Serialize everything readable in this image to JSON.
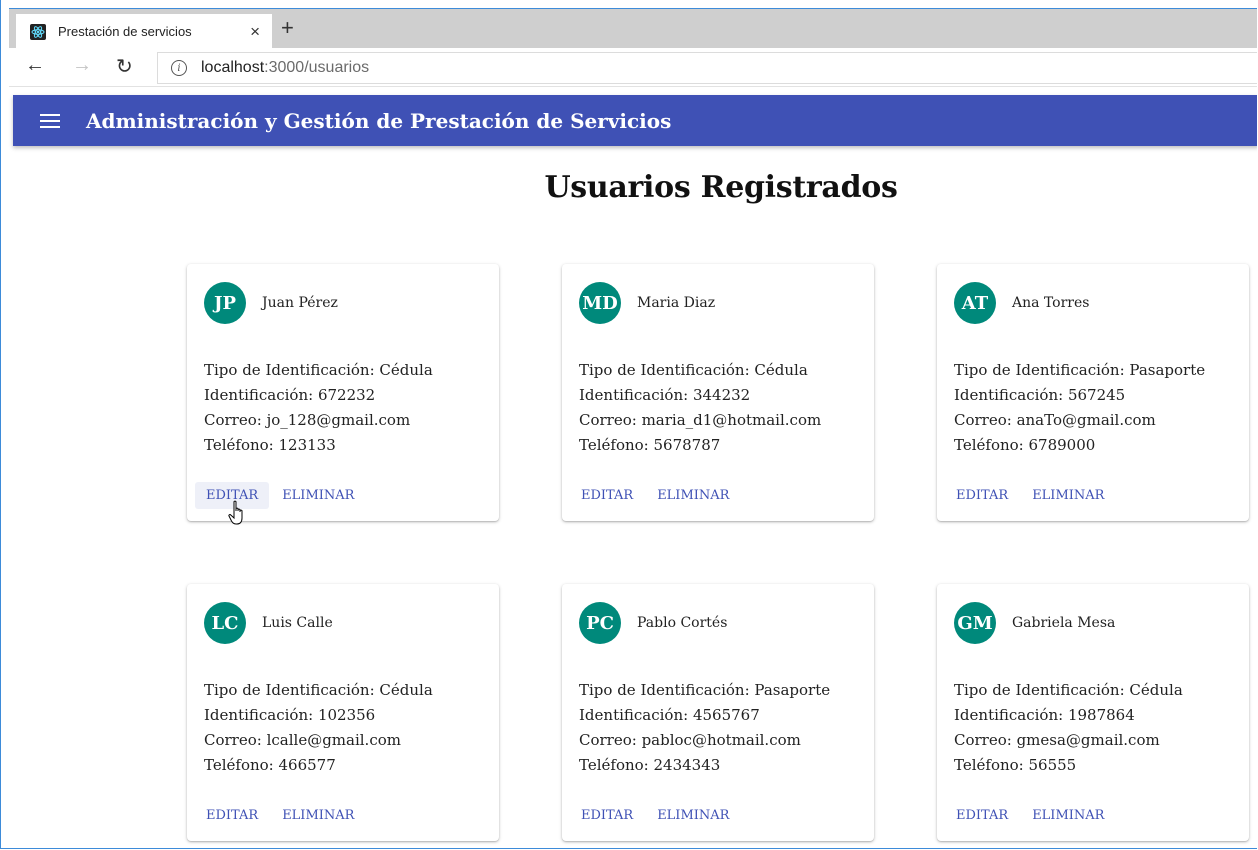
{
  "browser": {
    "tab_title": "Prestación de servicios",
    "tab_close": "×",
    "new_tab": "+",
    "back": "←",
    "forward": "→",
    "reload": "↻",
    "url_host": "localhost",
    "url_path": ":3000/usuarios"
  },
  "appbar": {
    "title": "Administración y Gestión de Prestación de Servicios"
  },
  "page": {
    "title": "Usuarios Registrados"
  },
  "labels": {
    "tipo": "Tipo de Identificación: ",
    "identificacion": "Identificación: ",
    "correo": "Correo: ",
    "telefono": "Teléfono: ",
    "edit": "EDITAR",
    "delete": "ELIMINAR"
  },
  "colors": {
    "primary": "#3f51b5",
    "avatar": "#00897b"
  },
  "users": [
    {
      "initials": "JP",
      "name": "Juan Pérez",
      "tipo": "Cédula",
      "id": "672232",
      "correo": "jo_128@gmail.com",
      "telefono": "123133"
    },
    {
      "initials": "MD",
      "name": "Maria Diaz",
      "tipo": "Cédula",
      "id": "344232",
      "correo": "maria_d1@hotmail.com",
      "telefono": "5678787"
    },
    {
      "initials": "AT",
      "name": "Ana Torres",
      "tipo": "Pasaporte",
      "id": "567245",
      "correo": "anaTo@gmail.com",
      "telefono": "6789000"
    },
    {
      "initials": "LC",
      "name": "Luis Calle",
      "tipo": "Cédula",
      "id": "102356",
      "correo": "lcalle@gmail.com",
      "telefono": "466577"
    },
    {
      "initials": "PC",
      "name": "Pablo Cortés",
      "tipo": "Pasaporte",
      "id": "4565767",
      "correo": "pabloc@hotmail.com",
      "telefono": "2434343"
    },
    {
      "initials": "GM",
      "name": "Gabriela Mesa",
      "tipo": "Cédula",
      "id": "1987864",
      "correo": "gmesa@gmail.com",
      "telefono": "56555"
    }
  ]
}
